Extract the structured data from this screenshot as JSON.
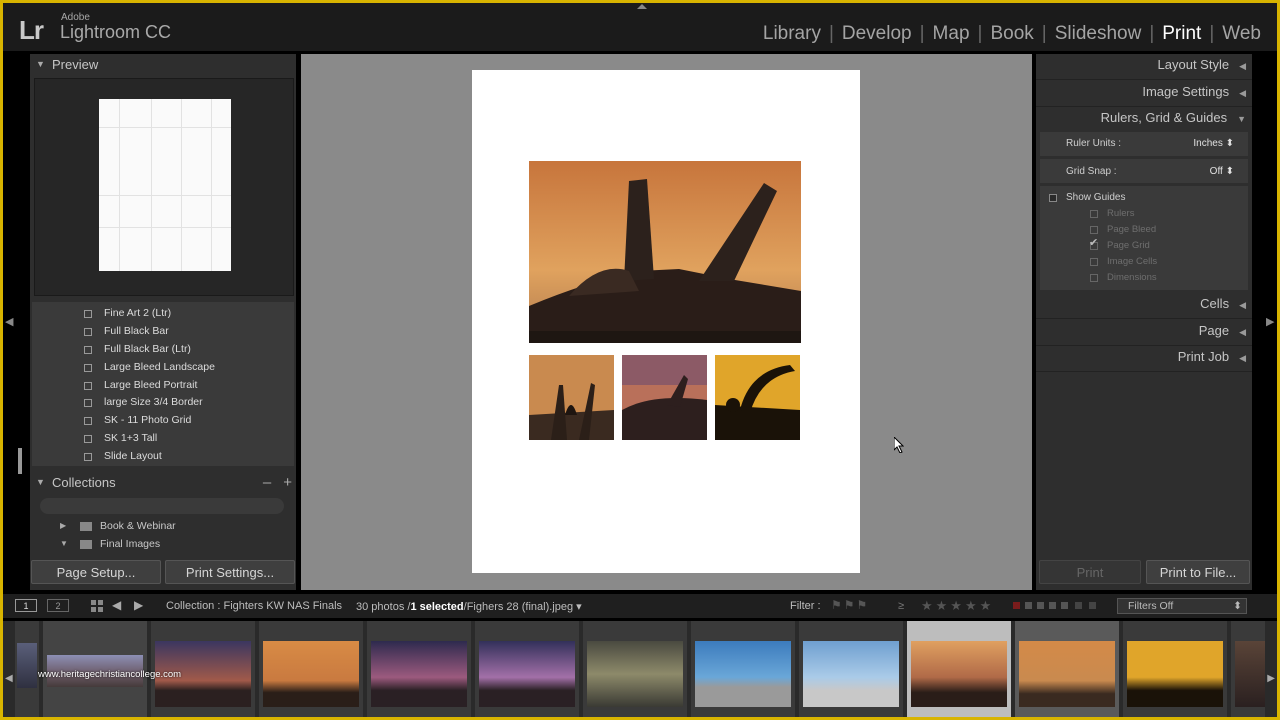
{
  "app": {
    "adobe": "Adobe",
    "name": "Lightroom CC",
    "lr": "Lr"
  },
  "modules": [
    {
      "label": "Library",
      "active": false
    },
    {
      "label": "Develop",
      "active": false
    },
    {
      "label": "Map",
      "active": false
    },
    {
      "label": "Book",
      "active": false
    },
    {
      "label": "Slideshow",
      "active": false
    },
    {
      "label": "Print",
      "active": true
    },
    {
      "label": "Web",
      "active": false
    }
  ],
  "left": {
    "preview_title": "Preview",
    "templates": [
      "Fine Art 2 (Ltr)",
      "Full Black Bar",
      "Full Black Bar (Ltr)",
      "Large Bleed Landscape",
      "Large Bleed Portrait",
      "large Size 3/4 Border",
      "SK - 11 Photo Grid",
      "SK 1+3 Tall",
      "Slide Layout"
    ],
    "collections_title": "Collections",
    "collections_minus": "–",
    "collections_plus": "+",
    "collections": [
      "Book & Webinar",
      "Final Images"
    ],
    "page_setup": "Page Setup...",
    "print_settings": "Print Settings..."
  },
  "right": {
    "layout_style": "Layout Style",
    "image_settings": "Image Settings",
    "rulers": "Rulers, Grid & Guides",
    "ruler_units_label": "Ruler Units :",
    "ruler_units_value": "Inches",
    "grid_snap_label": "Grid Snap :",
    "grid_snap_value": "Off",
    "show_guides": "Show Guides",
    "guides": [
      {
        "label": "Rulers",
        "checked": false
      },
      {
        "label": "Page Bleed",
        "checked": false
      },
      {
        "label": "Page Grid",
        "checked": true
      },
      {
        "label": "Image Cells",
        "checked": false
      },
      {
        "label": "Dimensions",
        "checked": false
      }
    ],
    "cells": "Cells",
    "page": "Page",
    "print_job": "Print Job",
    "print_btn": "Print",
    "print_to_file": "Print to File..."
  },
  "filmbar": {
    "mon1": "1",
    "mon2": "2",
    "collection": "Collection : Fighters KW NAS Finals",
    "photos": "30 photos /",
    "selected": "1 selected",
    "file": "/Fighers 28 (final).jpeg",
    "filter_label": "Filter :",
    "filter_value": "Filters Off",
    "ge": "≥"
  },
  "watermark": "www.heritagechristiancollege.com",
  "colors": {
    "accent_frame": "#d8b400",
    "panel": "#2e2e2e",
    "canvas": "#8a8a8a"
  }
}
